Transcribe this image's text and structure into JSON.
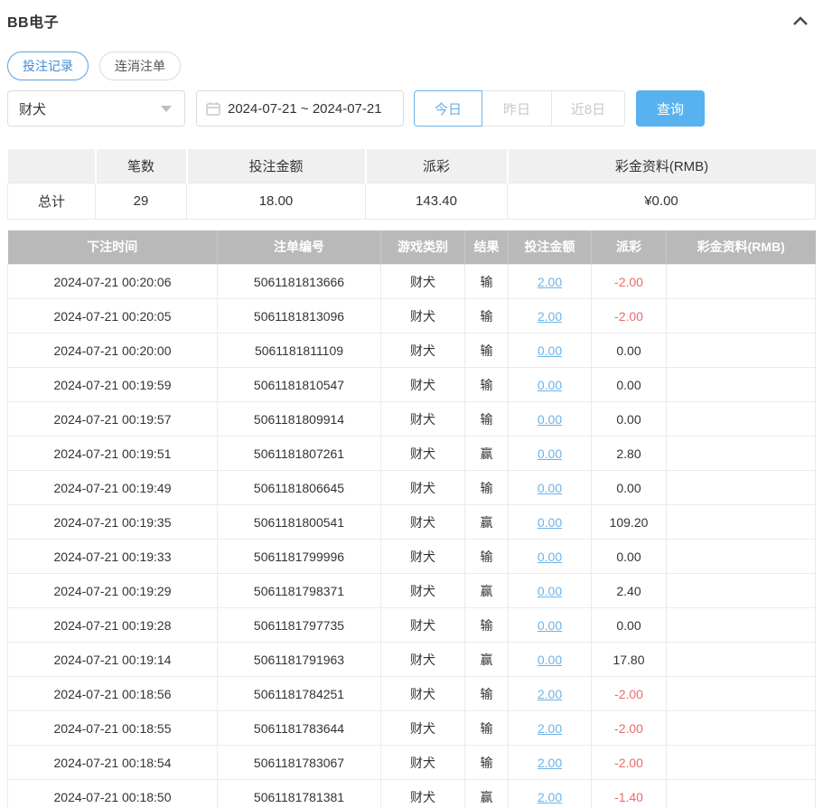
{
  "header": {
    "title": "BB电子",
    "collapse_icon": "chevron-up"
  },
  "tabs": [
    {
      "label": "投注记录",
      "active": true
    },
    {
      "label": "连消注单",
      "active": false
    }
  ],
  "filters": {
    "game_select": {
      "value": "财犬"
    },
    "date_range": {
      "value": "2024-07-21 ~ 2024-07-21"
    },
    "quick_ranges": [
      {
        "label": "今日",
        "active": true
      },
      {
        "label": "昨日",
        "active": false
      },
      {
        "label": "近8日",
        "active": false
      }
    ],
    "query_label": "查询"
  },
  "summary": {
    "columns": [
      "",
      "笔数",
      "投注金额",
      "派彩",
      "彩金资料(RMB)"
    ],
    "row_label": "总计",
    "count": "29",
    "bet_amount": "18.00",
    "payout": "143.40",
    "bonus": "¥0.00"
  },
  "records": {
    "columns": [
      "下注时间",
      "注单编号",
      "游戏类别",
      "结果",
      "投注金额",
      "派彩",
      "彩金资料(RMB)"
    ],
    "rows": [
      {
        "time": "2024-07-21 00:20:06",
        "order_no": "5061181813666",
        "game": "财犬",
        "result": "输",
        "bet": "2.00",
        "payout": "-2.00",
        "neg": true,
        "bonus": ""
      },
      {
        "time": "2024-07-21 00:20:05",
        "order_no": "5061181813096",
        "game": "财犬",
        "result": "输",
        "bet": "2.00",
        "payout": "-2.00",
        "neg": true,
        "bonus": ""
      },
      {
        "time": "2024-07-21 00:20:00",
        "order_no": "5061181811109",
        "game": "财犬",
        "result": "输",
        "bet": "0.00",
        "payout": "0.00",
        "neg": false,
        "bonus": ""
      },
      {
        "time": "2024-07-21 00:19:59",
        "order_no": "5061181810547",
        "game": "财犬",
        "result": "输",
        "bet": "0.00",
        "payout": "0.00",
        "neg": false,
        "bonus": ""
      },
      {
        "time": "2024-07-21 00:19:57",
        "order_no": "5061181809914",
        "game": "财犬",
        "result": "输",
        "bet": "0.00",
        "payout": "0.00",
        "neg": false,
        "bonus": ""
      },
      {
        "time": "2024-07-21 00:19:51",
        "order_no": "5061181807261",
        "game": "财犬",
        "result": "赢",
        "bet": "0.00",
        "payout": "2.80",
        "neg": false,
        "bonus": ""
      },
      {
        "time": "2024-07-21 00:19:49",
        "order_no": "5061181806645",
        "game": "财犬",
        "result": "输",
        "bet": "0.00",
        "payout": "0.00",
        "neg": false,
        "bonus": ""
      },
      {
        "time": "2024-07-21 00:19:35",
        "order_no": "5061181800541",
        "game": "财犬",
        "result": "赢",
        "bet": "0.00",
        "payout": "109.20",
        "neg": false,
        "bonus": ""
      },
      {
        "time": "2024-07-21 00:19:33",
        "order_no": "5061181799996",
        "game": "财犬",
        "result": "输",
        "bet": "0.00",
        "payout": "0.00",
        "neg": false,
        "bonus": ""
      },
      {
        "time": "2024-07-21 00:19:29",
        "order_no": "5061181798371",
        "game": "财犬",
        "result": "赢",
        "bet": "0.00",
        "payout": "2.40",
        "neg": false,
        "bonus": ""
      },
      {
        "time": "2024-07-21 00:19:28",
        "order_no": "5061181797735",
        "game": "财犬",
        "result": "输",
        "bet": "0.00",
        "payout": "0.00",
        "neg": false,
        "bonus": ""
      },
      {
        "time": "2024-07-21 00:19:14",
        "order_no": "5061181791963",
        "game": "财犬",
        "result": "赢",
        "bet": "0.00",
        "payout": "17.80",
        "neg": false,
        "bonus": ""
      },
      {
        "time": "2024-07-21 00:18:56",
        "order_no": "5061181784251",
        "game": "财犬",
        "result": "输",
        "bet": "2.00",
        "payout": "-2.00",
        "neg": true,
        "bonus": ""
      },
      {
        "time": "2024-07-21 00:18:55",
        "order_no": "5061181783644",
        "game": "财犬",
        "result": "输",
        "bet": "2.00",
        "payout": "-2.00",
        "neg": true,
        "bonus": ""
      },
      {
        "time": "2024-07-21 00:18:54",
        "order_no": "5061181783067",
        "game": "财犬",
        "result": "输",
        "bet": "2.00",
        "payout": "-2.00",
        "neg": true,
        "bonus": ""
      },
      {
        "time": "2024-07-21 00:18:50",
        "order_no": "5061181781381",
        "game": "财犬",
        "result": "赢",
        "bet": "2.00",
        "payout": "-1.40",
        "neg": true,
        "bonus": ""
      }
    ]
  },
  "colors": {
    "accent_blue": "#58b2f0",
    "link_blue": "#6db3e6",
    "tab_active_blue": "#3f8cd6",
    "negative_red": "#ef6a6a",
    "table_header_gray": "#b9b9b9",
    "summary_header_gray": "#f0f0f0"
  }
}
